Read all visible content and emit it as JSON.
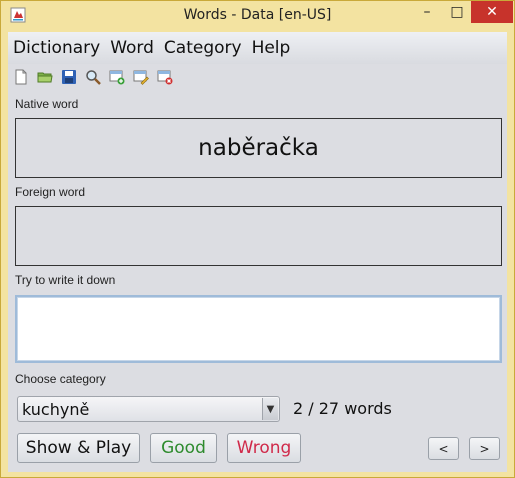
{
  "window": {
    "title": "Words - Data [en-US]",
    "controls": {
      "minimize": "–",
      "maximize": "□",
      "close": "✕"
    }
  },
  "menu": {
    "items": [
      {
        "label": "Dictionary"
      },
      {
        "label": "Word"
      },
      {
        "label": "Category"
      },
      {
        "label": "Help"
      }
    ]
  },
  "toolbar": {
    "icons": [
      "new-file-icon",
      "open-folder-icon",
      "save-icon",
      "search-icon",
      "add-item-icon",
      "edit-item-icon",
      "delete-item-icon"
    ]
  },
  "form": {
    "native_label": "Native word",
    "native_value": "naběračka",
    "foreign_label": "Foreign word",
    "foreign_value": "",
    "write_label": "Try to write it down",
    "write_value": "",
    "category_label": "Choose category",
    "category_selected": "kuchyně",
    "word_count": "2 / 27 words"
  },
  "buttons": {
    "show_play": "Show & Play",
    "good": "Good",
    "wrong": "Wrong",
    "prev": "<",
    "next": ">"
  },
  "colors": {
    "title_bar": "#f3e3a1",
    "close_button": "#c7332b",
    "good_text": "#2e8b2e",
    "wrong_text": "#d02a4a"
  }
}
